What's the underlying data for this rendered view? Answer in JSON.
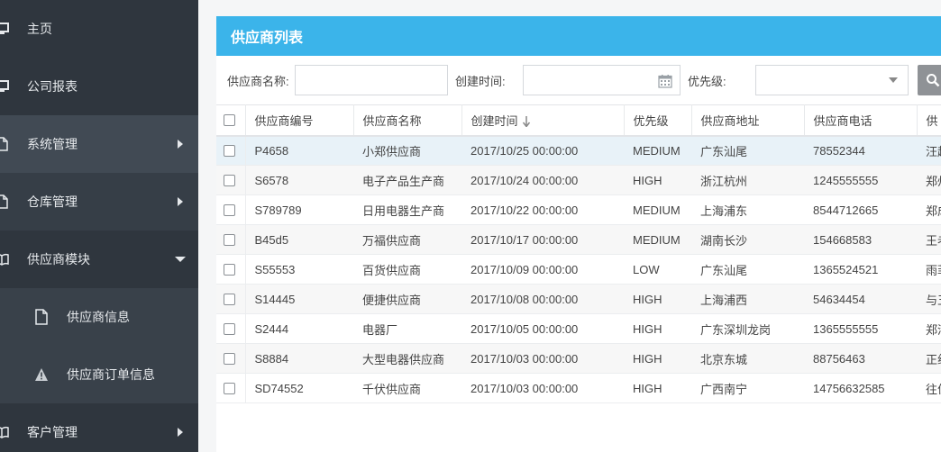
{
  "sidebar": {
    "items": [
      {
        "label": "主页",
        "icon": "monitor-icon"
      },
      {
        "label": "公司报表",
        "icon": "monitor-icon"
      },
      {
        "label": "系统管理",
        "icon": "file-icon"
      },
      {
        "label": "仓库管理",
        "icon": "file-icon"
      },
      {
        "label": "供应商模块",
        "icon": "book-icon"
      },
      {
        "label": "供应商信息",
        "icon": "file-icon"
      },
      {
        "label": "供应商订单信息",
        "icon": "warning-icon"
      },
      {
        "label": "客户管理",
        "icon": "book-icon"
      }
    ]
  },
  "panel": {
    "title": "供应商列表"
  },
  "filter": {
    "name_label": "供应商名称:",
    "name_value": "",
    "created_label": "创建时间:",
    "created_value": "",
    "priority_label": "优先级:",
    "priority_value": ""
  },
  "table": {
    "columns": [
      "供应商编号",
      "供应商名称",
      "创建时间",
      "优先级",
      "供应商地址",
      "供应商电话",
      "供"
    ],
    "rows": [
      [
        "P4658",
        "小郑供应商",
        "2017/10/25 00:00:00",
        "MEDIUM",
        "广东汕尾",
        "78552344",
        "汪超"
      ],
      [
        "S6578",
        "电子产品生产商",
        "2017/10/24 00:00:00",
        "HIGH",
        "浙江杭州",
        "1245555555",
        "郑州"
      ],
      [
        "S789789",
        "日用电器生产商",
        "2017/10/22 00:00:00",
        "MEDIUM",
        "上海浦东",
        "8544712665",
        "郑成"
      ],
      [
        "B45d5",
        "万福供应商",
        "2017/10/17 00:00:00",
        "MEDIUM",
        "湖南长沙",
        "154668583",
        "王老"
      ],
      [
        "S55553",
        "百货供应商",
        "2017/10/09 00:00:00",
        "LOW",
        "广东汕尾",
        "1365524521",
        "雨菲"
      ],
      [
        "S14445",
        "便捷供应商",
        "2017/10/08 00:00:00",
        "HIGH",
        "上海浦西",
        "54634454",
        "与五"
      ],
      [
        "S2444",
        "电器厂",
        "2017/10/05 00:00:00",
        "HIGH",
        "广东深圳龙岗",
        "1365555555",
        "郑清"
      ],
      [
        "S8884",
        "大型电器供应商",
        "2017/10/03 00:00:00",
        "HIGH",
        "北京东城",
        "88756463",
        "正组"
      ],
      [
        "SD74552",
        "千伏供应商",
        "2017/10/03 00:00:00",
        "HIGH",
        "广西南宁",
        "14756632585",
        "往佳"
      ]
    ]
  }
}
